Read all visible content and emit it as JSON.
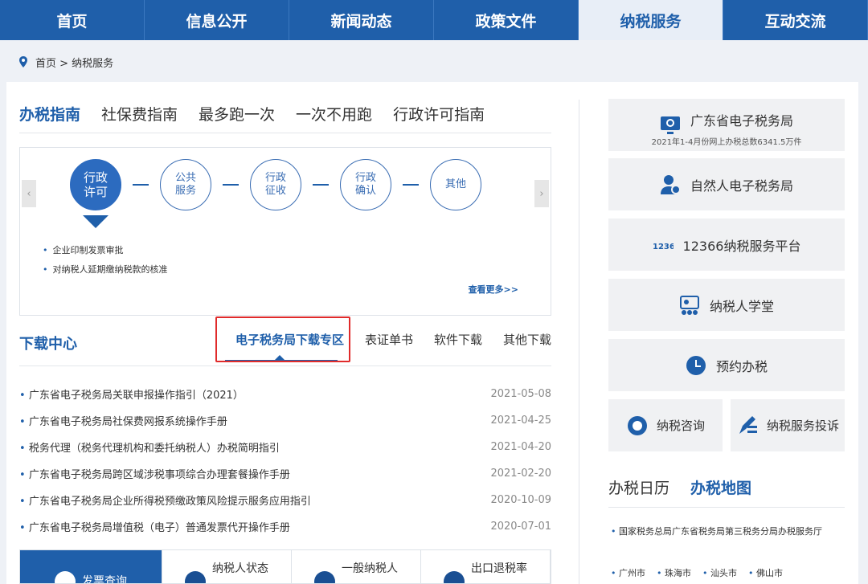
{
  "nav": [
    "首页",
    "信息公开",
    "新闻动态",
    "政策文件",
    "纳税服务",
    "互动交流"
  ],
  "breadcrumb": "首页 > 纳税服务",
  "guide_tabs": [
    "办税指南",
    "社保费指南",
    "最多跑一次",
    "一次不用跑",
    "行政许可指南"
  ],
  "steps": [
    "行政许可",
    "公共服务",
    "行政征收",
    "行政确认",
    "其他"
  ],
  "arrows": {
    "left": "‹",
    "right": "›"
  },
  "bullets": [
    "企业印制发票审批",
    "对纳税人延期缴纳税款的核准"
  ],
  "more_label": "查看更多>>",
  "download": {
    "title": "下载中心",
    "tabs": [
      "电子税务局下载专区",
      "表证单书",
      "软件下载",
      "其他下载"
    ],
    "items": [
      {
        "title": "广东省电子税务局关联申报操作指引（2021）",
        "date": "2021-05-08"
      },
      {
        "title": "广东省电子税务局社保费网报系统操作手册",
        "date": "2021-04-25"
      },
      {
        "title": "税务代理（税务代理机构和委托纳税人）办税简明指引",
        "date": "2021-04-20"
      },
      {
        "title": "广东省电子税务局跨区域涉税事项综合办理套餐操作手册",
        "date": "2021-02-20"
      },
      {
        "title": "广东省电子税务局企业所得税预缴政策风险提示服务应用指引",
        "date": "2020-10-09"
      },
      {
        "title": "广东省电子税务局增值税（电子）普通发票代开操作手册",
        "date": "2020-07-01"
      }
    ]
  },
  "tiles": [
    "发票查询",
    "纳税人状态",
    "一般纳税人",
    "出口退税率"
  ],
  "right": {
    "etax": {
      "label": "广东省电子税务局",
      "note": "2021年1-4月份网上办税总数6341.5万件"
    },
    "person": "自然人电子税务局",
    "hotline": "12366纳税服务平台",
    "school": "纳税人学堂",
    "appointment": "预约办税",
    "consult": "纳税咨询",
    "complaint": "纳税服务投诉"
  },
  "calendar_tabs": [
    "办税日历",
    "办税地图"
  ],
  "office": "国家税务总局广东省税务局第三税务分局办税服务厅",
  "cities": [
    "广州市",
    "珠海市",
    "汕头市",
    "佛山市"
  ],
  "colors": {
    "brand": "#1f5faa",
    "highlight": "#e02b2b"
  },
  "icons": [
    "location-pin-icon",
    "computer-icon",
    "person-icon",
    "12366-icon",
    "classroom-icon",
    "clock-icon",
    "headset-icon",
    "pen-icon"
  ]
}
